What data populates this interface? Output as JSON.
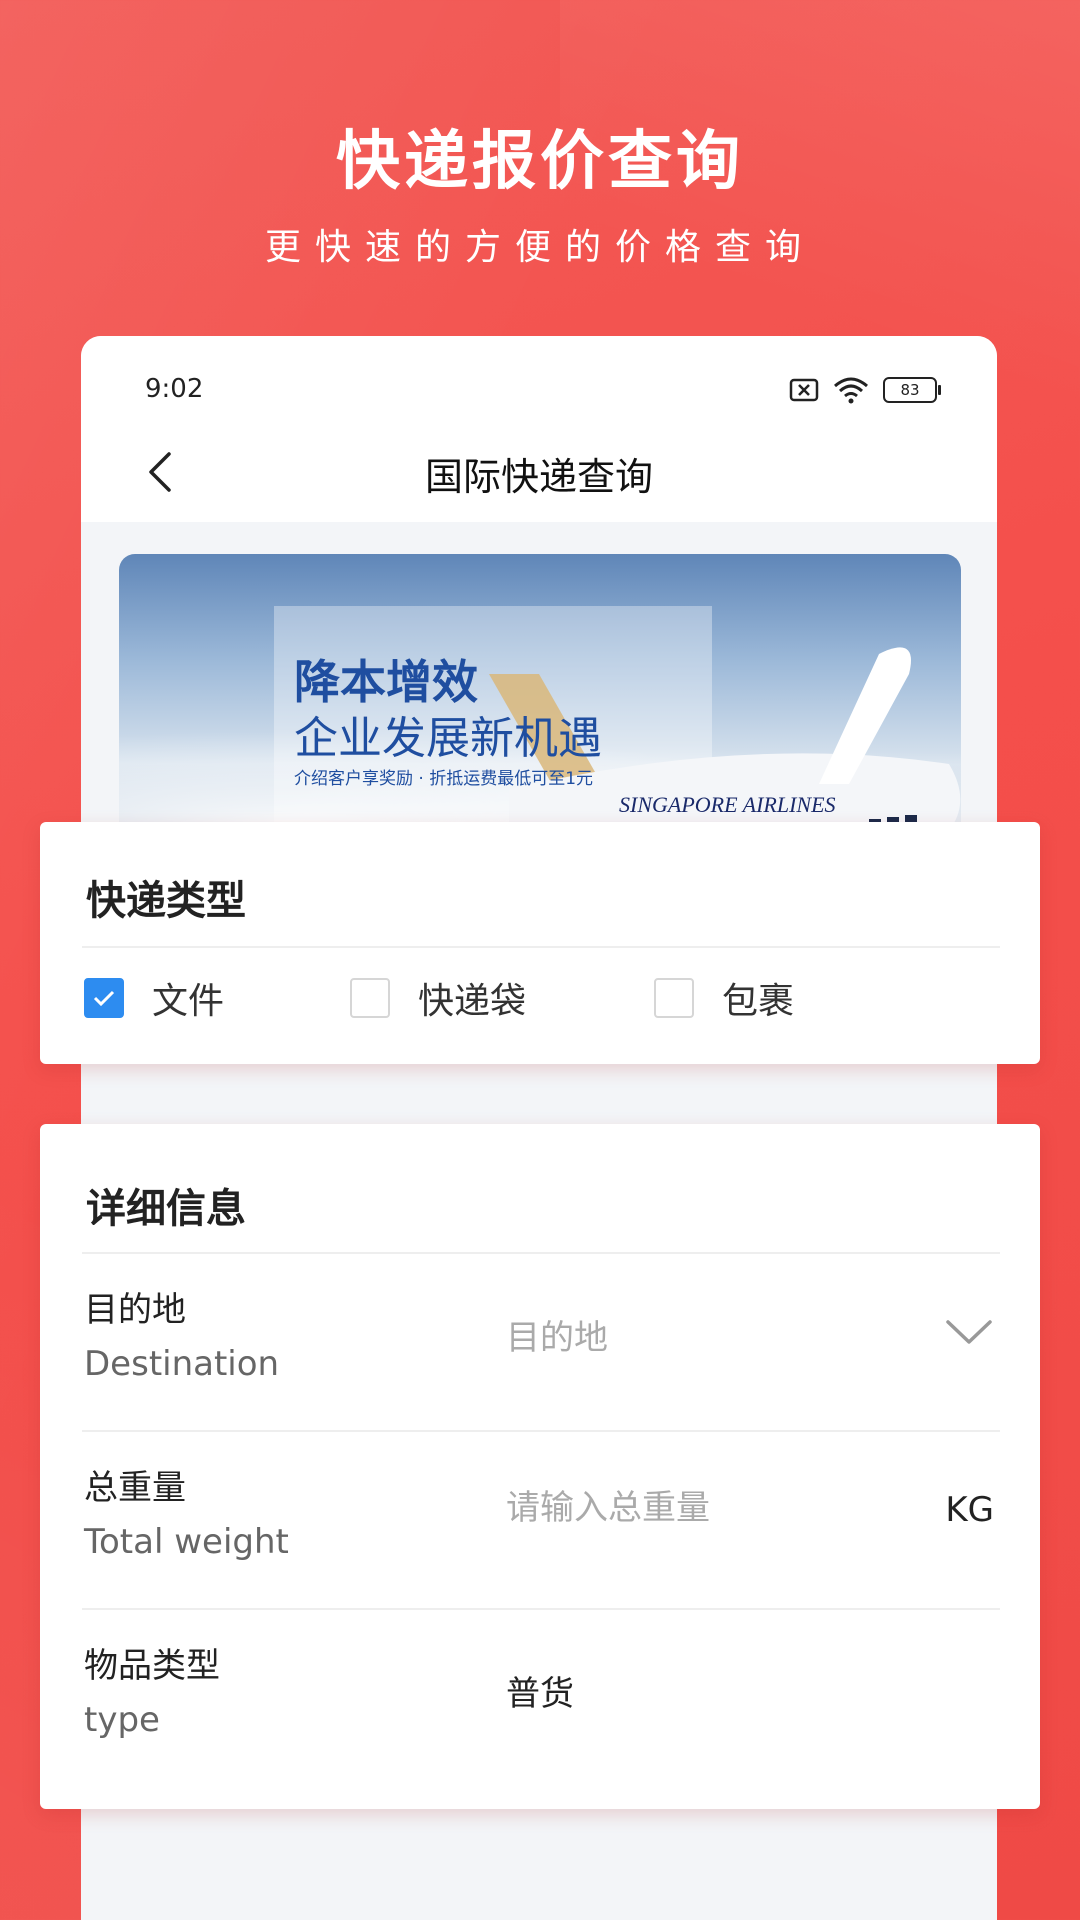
{
  "promo": {
    "title": "快递报价查询",
    "subtitle": "更快速的方便的价格查询"
  },
  "status_bar": {
    "time": "9:02",
    "battery": "83"
  },
  "nav": {
    "title": "国际快递查询"
  },
  "banner": {
    "headline": "降本增效",
    "subheadline": "企业发展新机遇",
    "tagline": "介绍客户享奖励 · 折抵运费最低可至1元",
    "airline_text": "SINGAPORE AIRLINES"
  },
  "express_type": {
    "title": "快递类型",
    "options": [
      {
        "label": "文件",
        "checked": true
      },
      {
        "label": "快递袋",
        "checked": false
      },
      {
        "label": "包裹",
        "checked": false
      }
    ]
  },
  "details": {
    "title": "详细信息",
    "destination": {
      "label_cn": "目的地",
      "label_en": "Destination",
      "placeholder": "目的地"
    },
    "weight": {
      "label_cn": "总重量",
      "label_en": "Total weight",
      "placeholder": "请输入总重量",
      "unit": "KG"
    },
    "item_type": {
      "label_cn": "物品类型",
      "label_en": "type",
      "value": "普货"
    }
  },
  "colors": {
    "brand_red": "#f44f4b",
    "checkbox_blue": "#2d8cf0"
  }
}
